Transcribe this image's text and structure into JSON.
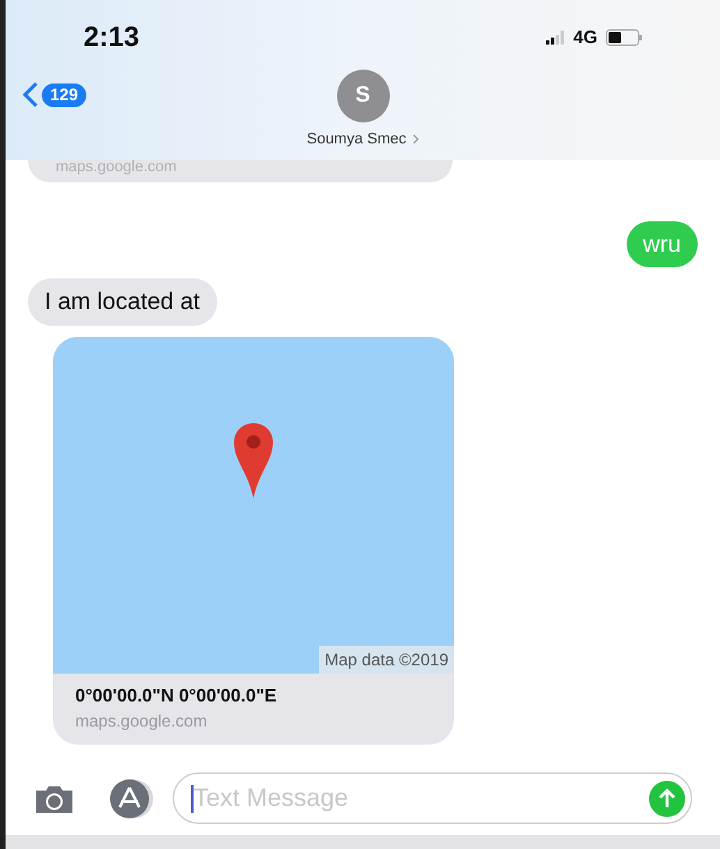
{
  "status_bar": {
    "time": "2:13",
    "network": "4G",
    "battery": {
      "level": 0.45
    }
  },
  "header": {
    "back_count": "129",
    "avatar_letter": "S",
    "contact_name": "Soumya Smec"
  },
  "messages": [
    {
      "kind": "fragment",
      "sent": false,
      "text": "maps.google.com"
    },
    {
      "kind": "text",
      "sent": true,
      "text": "wru"
    },
    {
      "kind": "text",
      "sent": false,
      "text": "I am located at"
    },
    {
      "kind": "location",
      "sent": false,
      "map_credit": "Map data ©2019",
      "title": "0°00'00.0\"N 0°00'00.0\"E",
      "domain": "maps.google.com"
    }
  ],
  "composer": {
    "placeholder": "Text Message"
  }
}
